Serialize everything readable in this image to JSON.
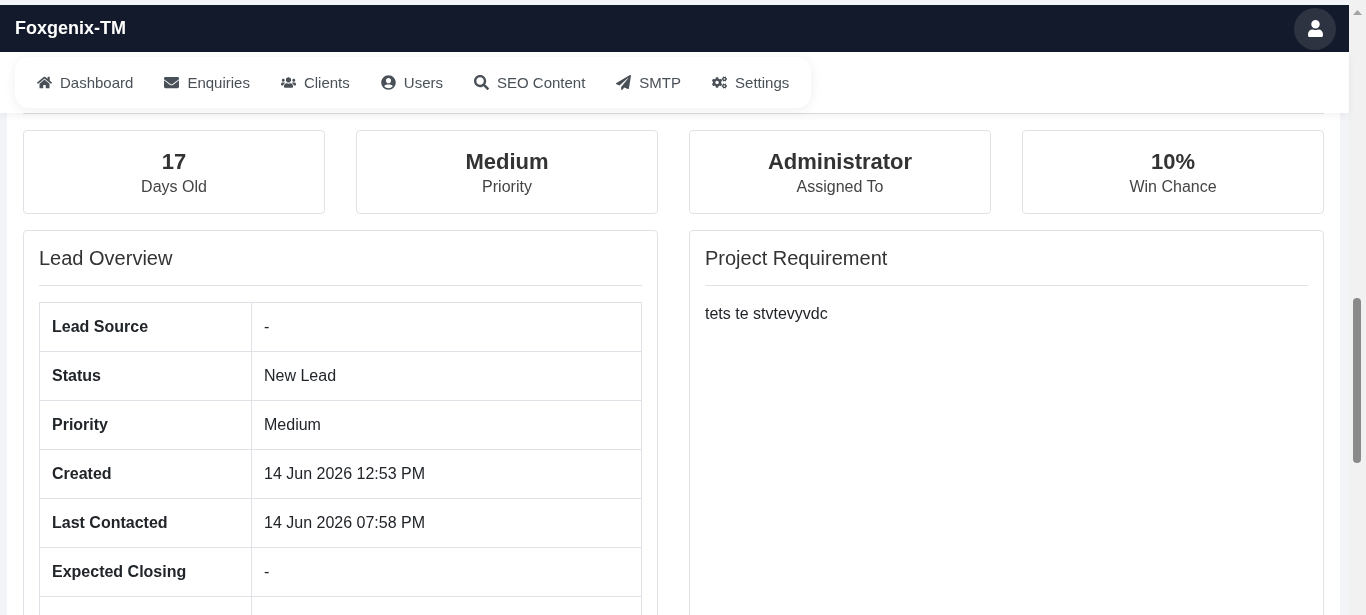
{
  "navbar": {
    "brand": "Foxgenix-TM"
  },
  "nav_menu": [
    {
      "label": "Dashboard"
    },
    {
      "label": "Enquiries"
    },
    {
      "label": "Clients"
    },
    {
      "label": "Users"
    },
    {
      "label": "SEO Content"
    },
    {
      "label": "SMTP"
    },
    {
      "label": "Settings"
    }
  ],
  "stats": [
    {
      "value": "17",
      "label": "Days Old"
    },
    {
      "value": "Medium",
      "label": "Priority"
    },
    {
      "value": "Administrator",
      "label": "Assigned To"
    },
    {
      "value": "10%",
      "label": "Win Chance"
    }
  ],
  "lead_overview": {
    "title": "Lead Overview",
    "rows": [
      {
        "label": "Lead Source",
        "value": "-"
      },
      {
        "label": "Status",
        "value": "New Lead"
      },
      {
        "label": "Priority",
        "value": "Medium"
      },
      {
        "label": "Created",
        "value": "14 Jun 2026 12:53 PM"
      },
      {
        "label": "Last Contacted",
        "value": "14 Jun 2026 07:58 PM"
      },
      {
        "label": "Expected Closing",
        "value": "-"
      }
    ]
  },
  "project_requirement": {
    "title": "Project Requirement",
    "text": "tets te stvtevyvdc"
  }
}
